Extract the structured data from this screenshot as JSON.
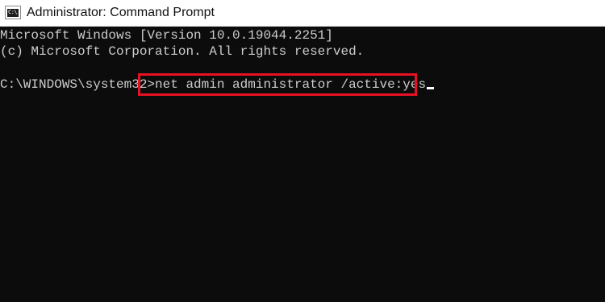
{
  "window": {
    "title": "Administrator: Command Prompt",
    "icon": "command-prompt-icon",
    "icon_glyph": "C:\\."
  },
  "console": {
    "lines": [
      "Microsoft Windows [Version 10.0.19044.2251]",
      "(c) Microsoft Corporation. All rights reserved."
    ],
    "prompt": "C:\\WINDOWS\\system32>",
    "command": "net admin administrator /active:yes",
    "text_color": "#cccccc",
    "background_color": "#0c0c0c"
  },
  "annotation": {
    "highlight_color": "#e81123"
  }
}
